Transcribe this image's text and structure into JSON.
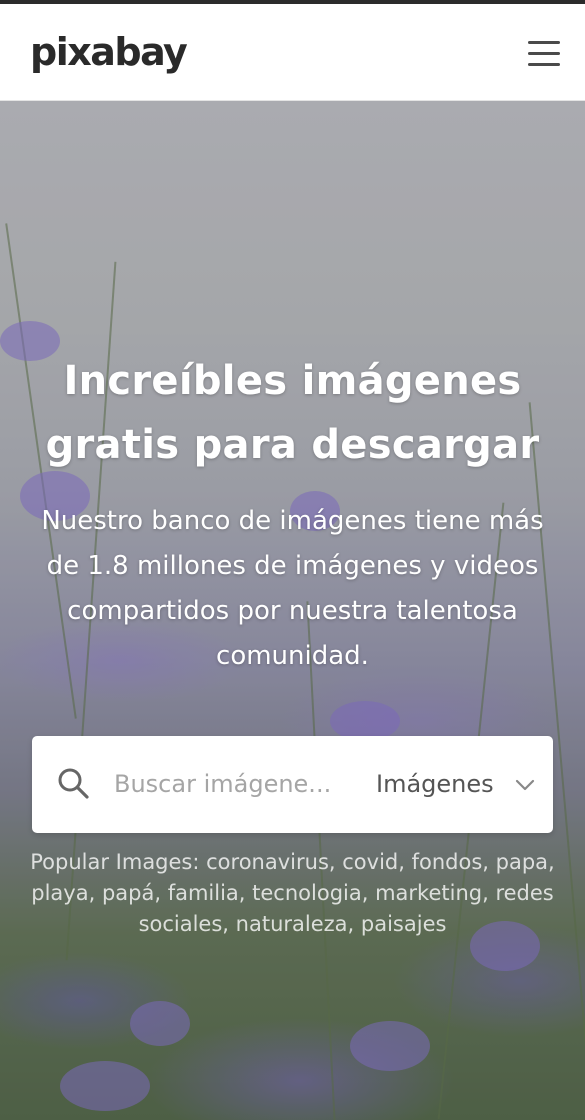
{
  "header": {
    "logo_text": "pixabay",
    "menu_icon": "hamburger-icon"
  },
  "hero": {
    "title_line1": "Increíbles imágenes",
    "title_line2": "gratis para descargar",
    "subtitle": "Nuestro banco de imágenes tiene más de 1.8 millones de imágenes y videos compartidos por nuestra talentosa comunidad."
  },
  "search": {
    "placeholder": "Buscar imágene...",
    "type_selected": "Imágenes",
    "search_icon": "search-icon",
    "dropdown_icon": "chevron-down-icon"
  },
  "popular": {
    "label": "Popular Images:",
    "tags": [
      "coronavirus",
      "covid",
      "fondos",
      "papa",
      "playa",
      "papá",
      "familia",
      "tecnologia",
      "marketing",
      "redes sociales",
      "naturaleza",
      "paisajes"
    ]
  },
  "colors": {
    "header_bg": "#ffffff",
    "top_strip": "#2b2b2b",
    "text_white": "#ffffff",
    "placeholder": "#a5a5a5"
  }
}
